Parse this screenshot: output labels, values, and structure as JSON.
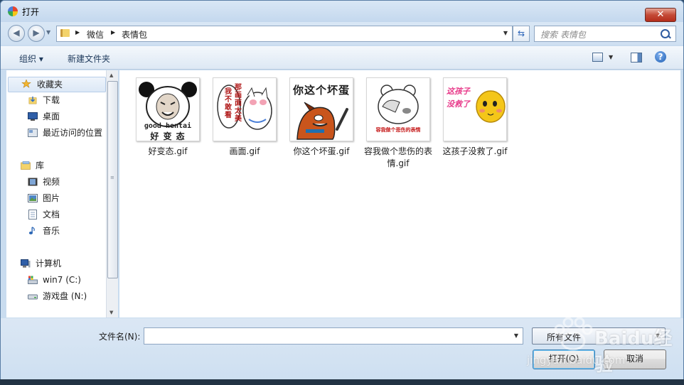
{
  "window": {
    "title": "打开",
    "close_label": "✕"
  },
  "nav": {
    "back": "◀",
    "forward": "▶",
    "breadcrumb": [
      "微信",
      "表情包"
    ],
    "search_placeholder": "搜索 表情包",
    "refresh": "⇆"
  },
  "toolbar": {
    "organize": "组织 ▾",
    "new_folder": "新建文件夹",
    "help": "?"
  },
  "sidebar": {
    "favorites": "收藏夹",
    "downloads": "下载",
    "desktop": "桌面",
    "recent": "最近访问的位置",
    "libraries": "库",
    "videos": "视频",
    "pictures": "图片",
    "documents": "文档",
    "music": "音乐",
    "computer": "计算机",
    "drive_c": "win7 (C:)",
    "drive_n": "游戏盘 (N:)"
  },
  "files": [
    {
      "name": "好变态.gif",
      "caption_line1": "good hentai",
      "caption_line2": "好 变 态"
    },
    {
      "name": "画面.gif",
      "caption_line1": "我不敢看",
      "caption_line2": "那画面太美"
    },
    {
      "name": "你这个坏蛋.gif",
      "caption_line1": "你这个坏蛋"
    },
    {
      "name": "容我做个悲伤的表情.gif",
      "caption_line1": "容我做个悲伤的表情"
    },
    {
      "name": "这孩子没救了.gif",
      "caption_line1": "这孩子",
      "caption_line2": "没救了"
    }
  ],
  "bottom": {
    "filename_label": "文件名(N):",
    "filename_value": "",
    "filter_value": "所有文件",
    "open_label": "打开(O)",
    "cancel_label": "取消"
  },
  "watermark": {
    "text": "Baidu经验",
    "url": "jingyan.baidu.com"
  },
  "icons": [
    "star-icon",
    "folder-icon",
    "desktop-icon",
    "recent-icon",
    "library-icon",
    "video-icon",
    "picture-icon",
    "document-icon",
    "music-icon",
    "computer-icon",
    "drive-icon",
    "search-icon",
    "help-icon"
  ]
}
